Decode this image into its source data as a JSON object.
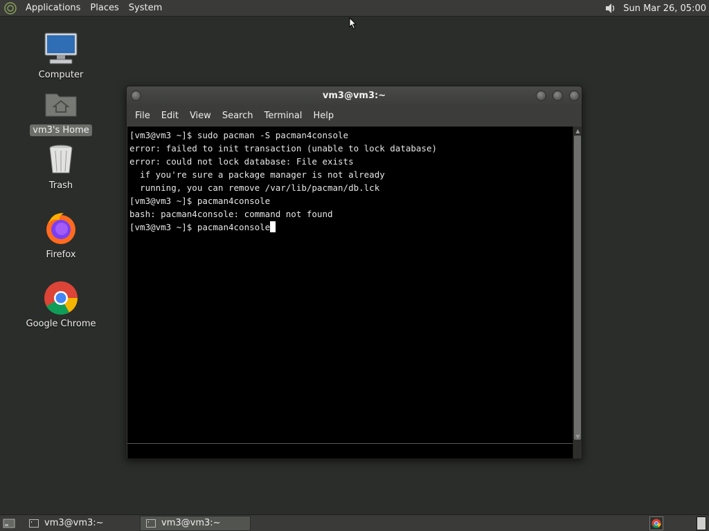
{
  "top_panel": {
    "menus": [
      "Applications",
      "Places",
      "System"
    ],
    "clock": "Sun Mar 26, 05:00"
  },
  "desktop": {
    "icons": [
      {
        "label": "Computer",
        "icon": "computer-icon"
      },
      {
        "label": "vm3's Home",
        "icon": "home-folder-icon",
        "selected": true
      },
      {
        "label": "Trash",
        "icon": "trash-icon"
      },
      {
        "label": "Firefox",
        "icon": "firefox-icon"
      },
      {
        "label": "Google Chrome",
        "icon": "chrome-icon"
      }
    ]
  },
  "window": {
    "title": "vm3@vm3:~",
    "menu": [
      "File",
      "Edit",
      "View",
      "Search",
      "Terminal",
      "Help"
    ],
    "terminal_lines": [
      "[vm3@vm3 ~]$ sudo pacman -S pacman4console",
      "error: failed to init transaction (unable to lock database)",
      "error: could not lock database: File exists",
      "  if you're sure a package manager is not already",
      "  running, you can remove /var/lib/pacman/db.lck",
      "[vm3@vm3 ~]$ pacman4console",
      "bash: pacman4console: command not found",
      "[vm3@vm3 ~]$ pacman4console"
    ]
  },
  "taskbar": {
    "tasks": [
      {
        "label": "vm3@vm3:~",
        "active": false
      },
      {
        "label": "vm3@vm3:~",
        "active": true
      }
    ]
  },
  "colors": {
    "desktop_bg": "#2b2d2a",
    "panel_bg": "#3a3b38",
    "terminal_bg": "#000000",
    "terminal_fg": "#e6e6e6"
  }
}
